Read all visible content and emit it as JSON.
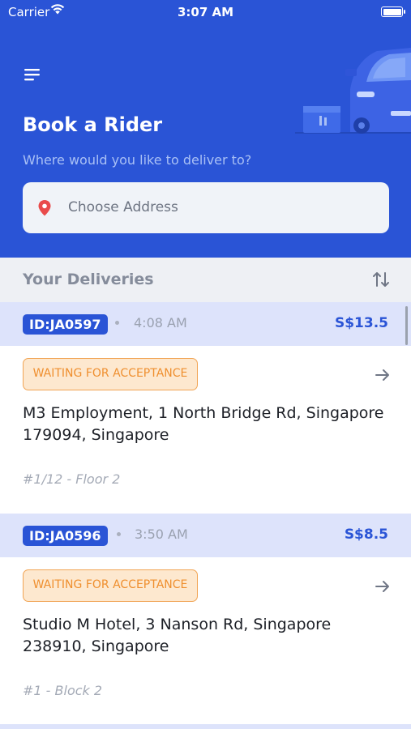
{
  "status_bar": {
    "carrier": "Carrier",
    "time": "3:07 AM"
  },
  "header": {
    "title": "Book a Rider",
    "subtitle": "Where would you like to deliver to?",
    "address_placeholder": "Choose Address"
  },
  "deliveries": {
    "heading": "Your Deliveries",
    "items": [
      {
        "id": "ID:JA0597",
        "time": "4:08 AM",
        "price": "S$13.5",
        "status": "WAITING FOR ACCEPTANCE",
        "address": "M3 Employment, 1 North Bridge Rd, Singapore 179094, Singapore",
        "unit": "#1/12 - Floor 2"
      },
      {
        "id": "ID:JA0596",
        "time": "3:50 AM",
        "price": "S$8.5",
        "status": "WAITING FOR ACCEPTANCE",
        "address": "Studio M Hotel, 3 Nanson Rd, Singapore 238910, Singapore",
        "unit": "#1 - Block 2"
      }
    ]
  },
  "colors": {
    "brand_blue": "#2a54d6",
    "status_orange": "#ef8f2f",
    "pin_red": "#e94b4b"
  },
  "icons": [
    "wifi-icon",
    "battery-icon",
    "menu-icon",
    "car-illustration",
    "location-pin-icon",
    "sort-icon",
    "arrow-right-icon"
  ]
}
